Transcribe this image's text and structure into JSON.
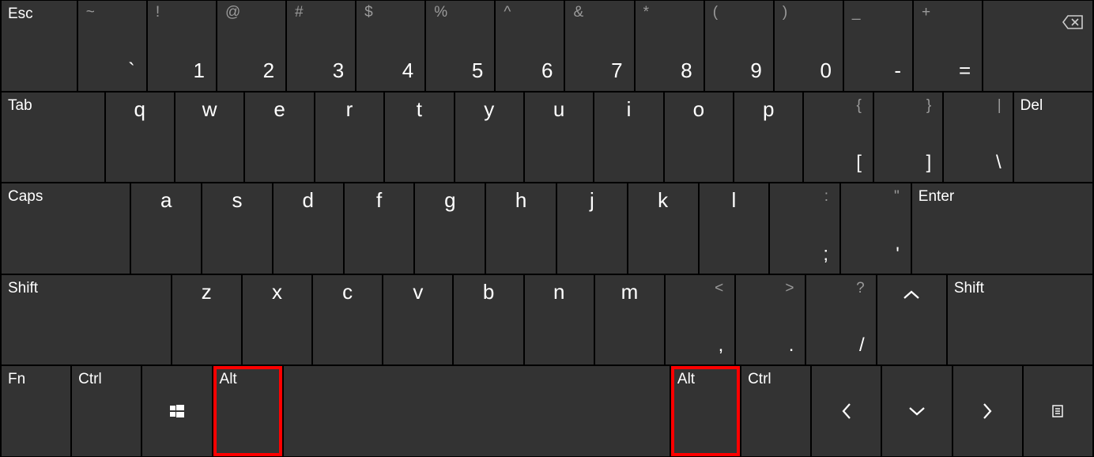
{
  "row1": {
    "esc": "Esc",
    "backtick": {
      "upper": "~",
      "lower": "`"
    },
    "d1": {
      "upper": "!",
      "lower": "1"
    },
    "d2": {
      "upper": "@",
      "lower": "2"
    },
    "d3": {
      "upper": "#",
      "lower": "3"
    },
    "d4": {
      "upper": "$",
      "lower": "4"
    },
    "d5": {
      "upper": "%",
      "lower": "5"
    },
    "d6": {
      "upper": "^",
      "lower": "6"
    },
    "d7": {
      "upper": "&",
      "lower": "7"
    },
    "d8": {
      "upper": "*",
      "lower": "8"
    },
    "d9": {
      "upper": "(",
      "lower": "9"
    },
    "d0": {
      "upper": ")",
      "lower": "0"
    },
    "minus": {
      "upper": "_",
      "lower": "-"
    },
    "equals": {
      "upper": "+",
      "lower": "="
    },
    "backspace": "⌫"
  },
  "row2": {
    "tab": "Tab",
    "q": "q",
    "w": "w",
    "e": "e",
    "r": "r",
    "t": "t",
    "y": "y",
    "u": "u",
    "i": "i",
    "o": "o",
    "p": "p",
    "lbracket": {
      "upper": "{",
      "lower": "["
    },
    "rbracket": {
      "upper": "}",
      "lower": "]"
    },
    "backslash": {
      "upper": "|",
      "lower": "\\"
    },
    "del": "Del"
  },
  "row3": {
    "caps": "Caps",
    "a": "a",
    "s": "s",
    "d": "d",
    "f": "f",
    "g": "g",
    "h": "h",
    "j": "j",
    "k": "k",
    "l": "l",
    "semicolon": {
      "upper": ":",
      "lower": ";"
    },
    "apostrophe": {
      "upper": "\"",
      "lower": "'"
    },
    "enter": "Enter"
  },
  "row4": {
    "shiftL": "Shift",
    "z": "z",
    "x": "x",
    "c": "c",
    "v": "v",
    "b": "b",
    "n": "n",
    "m": "m",
    "comma": {
      "upper": "<",
      "lower": ","
    },
    "period": {
      "upper": ">",
      "lower": "."
    },
    "slash": {
      "upper": "?",
      "lower": "/"
    },
    "up": "up",
    "shiftR": "Shift"
  },
  "row5": {
    "fn": "Fn",
    "ctrlL": "Ctrl",
    "win": "windows",
    "altL": "Alt",
    "space": "",
    "altR": "Alt",
    "ctrlR": "Ctrl",
    "left": "left",
    "down": "down",
    "right": "right",
    "menu": "menu"
  }
}
